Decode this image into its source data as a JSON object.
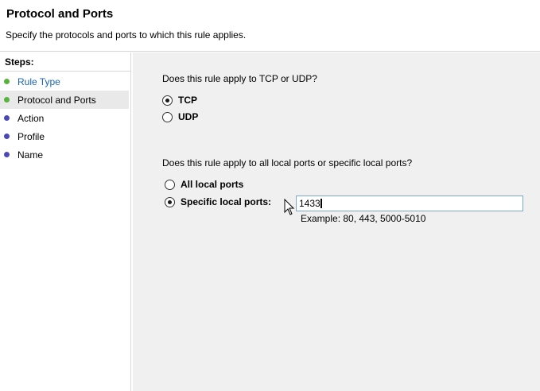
{
  "header": {
    "title": "Protocol and Ports",
    "subtitle": "Specify the protocols and ports to which this rule applies."
  },
  "steps": {
    "title": "Steps:",
    "items": [
      {
        "label": "Rule Type",
        "status": "done",
        "color": "#1a64b4",
        "dot": "#58b33a"
      },
      {
        "label": "Protocol and Ports",
        "status": "current",
        "color": "#000000",
        "dot": "#58b33a"
      },
      {
        "label": "Action",
        "status": "pending",
        "color": "#000000",
        "dot": "#4a48b8"
      },
      {
        "label": "Profile",
        "status": "pending",
        "color": "#000000",
        "dot": "#4a48b8"
      },
      {
        "label": "Name",
        "status": "pending",
        "color": "#000000",
        "dot": "#4a48b8"
      }
    ]
  },
  "protocol": {
    "question": "Does this rule apply to TCP or UDP?",
    "options": [
      {
        "label": "TCP",
        "checked": true
      },
      {
        "label": "UDP",
        "checked": false
      }
    ]
  },
  "ports": {
    "question": "Does this rule apply to all local ports or specific local ports?",
    "options": [
      {
        "label": "All local ports",
        "checked": false
      },
      {
        "label": "Specific local ports:",
        "checked": true
      }
    ],
    "input_value": "1433",
    "example": "Example: 80, 443, 5000-5010"
  }
}
